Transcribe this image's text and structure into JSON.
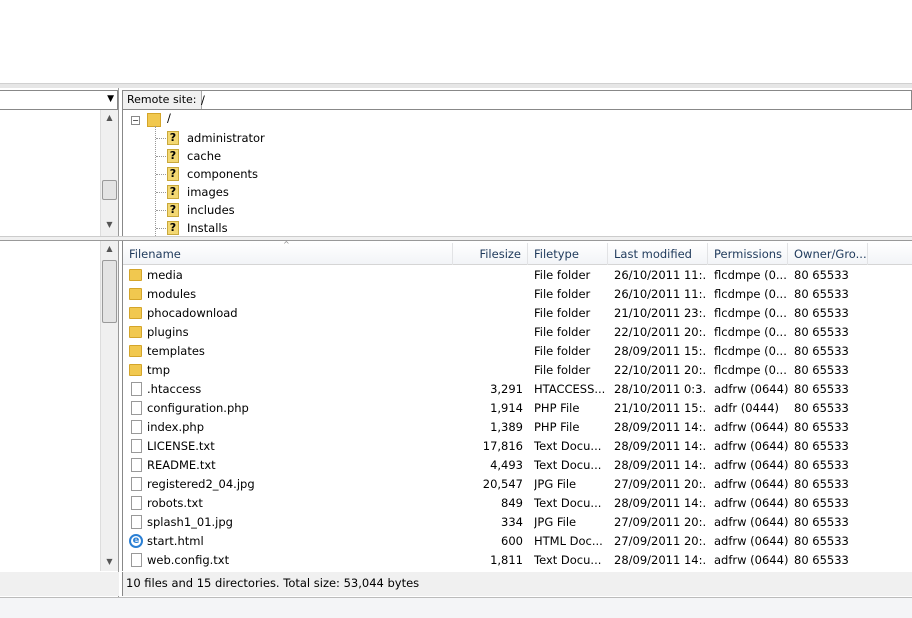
{
  "remote_site": {
    "label": "Remote site:",
    "path": "/"
  },
  "tree": {
    "root": "/",
    "items": [
      "administrator",
      "cache",
      "components",
      "images",
      "includes",
      "Installs"
    ]
  },
  "columns": [
    "Filename",
    "Filesize",
    "Filetype",
    "Last modified",
    "Permissions",
    "Owner/Gro..."
  ],
  "files": [
    {
      "name": "media",
      "size": "",
      "type": "File folder",
      "modified": "26/10/2011 11:...",
      "perms": "flcdmpe (0...",
      "owner": "80 65533",
      "icon": "folder"
    },
    {
      "name": "modules",
      "size": "",
      "type": "File folder",
      "modified": "26/10/2011 11:...",
      "perms": "flcdmpe (0...",
      "owner": "80 65533",
      "icon": "folder"
    },
    {
      "name": "phocadownload",
      "size": "",
      "type": "File folder",
      "modified": "21/10/2011 23:...",
      "perms": "flcdmpe (0...",
      "owner": "80 65533",
      "icon": "folder"
    },
    {
      "name": "plugins",
      "size": "",
      "type": "File folder",
      "modified": "22/10/2011 20:...",
      "perms": "flcdmpe (0...",
      "owner": "80 65533",
      "icon": "folder"
    },
    {
      "name": "templates",
      "size": "",
      "type": "File folder",
      "modified": "28/09/2011 15:...",
      "perms": "flcdmpe (0...",
      "owner": "80 65533",
      "icon": "folder"
    },
    {
      "name": "tmp",
      "size": "",
      "type": "File folder",
      "modified": "22/10/2011 20:...",
      "perms": "flcdmpe (0...",
      "owner": "80 65533",
      "icon": "folder"
    },
    {
      "name": ".htaccess",
      "size": "3,291",
      "type": "HTACCESS...",
      "modified": "28/10/2011 0:3...",
      "perms": "adfrw (0644)",
      "owner": "80 65533",
      "icon": "file"
    },
    {
      "name": "configuration.php",
      "size": "1,914",
      "type": "PHP File",
      "modified": "21/10/2011 15:...",
      "perms": "adfr (0444)",
      "owner": "80 65533",
      "icon": "file"
    },
    {
      "name": "index.php",
      "size": "1,389",
      "type": "PHP File",
      "modified": "28/09/2011 14:...",
      "perms": "adfrw (0644)",
      "owner": "80 65533",
      "icon": "file"
    },
    {
      "name": "LICENSE.txt",
      "size": "17,816",
      "type": "Text Docu...",
      "modified": "28/09/2011 14:...",
      "perms": "adfrw (0644)",
      "owner": "80 65533",
      "icon": "file"
    },
    {
      "name": "README.txt",
      "size": "4,493",
      "type": "Text Docu...",
      "modified": "28/09/2011 14:...",
      "perms": "adfrw (0644)",
      "owner": "80 65533",
      "icon": "file"
    },
    {
      "name": "registered2_04.jpg",
      "size": "20,547",
      "type": "JPG File",
      "modified": "27/09/2011 20:...",
      "perms": "adfrw (0644)",
      "owner": "80 65533",
      "icon": "file"
    },
    {
      "name": "robots.txt",
      "size": "849",
      "type": "Text Docu...",
      "modified": "28/09/2011 14:...",
      "perms": "adfrw (0644)",
      "owner": "80 65533",
      "icon": "file"
    },
    {
      "name": "splash1_01.jpg",
      "size": "334",
      "type": "JPG File",
      "modified": "27/09/2011 20:...",
      "perms": "adfrw (0644)",
      "owner": "80 65533",
      "icon": "file"
    },
    {
      "name": "start.html",
      "size": "600",
      "type": "HTML Doc...",
      "modified": "27/09/2011 20:...",
      "perms": "adfrw (0644)",
      "owner": "80 65533",
      "icon": "ie"
    },
    {
      "name": "web.config.txt",
      "size": "1,811",
      "type": "Text Docu...",
      "modified": "28/09/2011 14:...",
      "perms": "adfrw (0644)",
      "owner": "80 65533",
      "icon": "file"
    }
  ],
  "status": "10 files and 15 directories. Total size: 53,044 bytes"
}
